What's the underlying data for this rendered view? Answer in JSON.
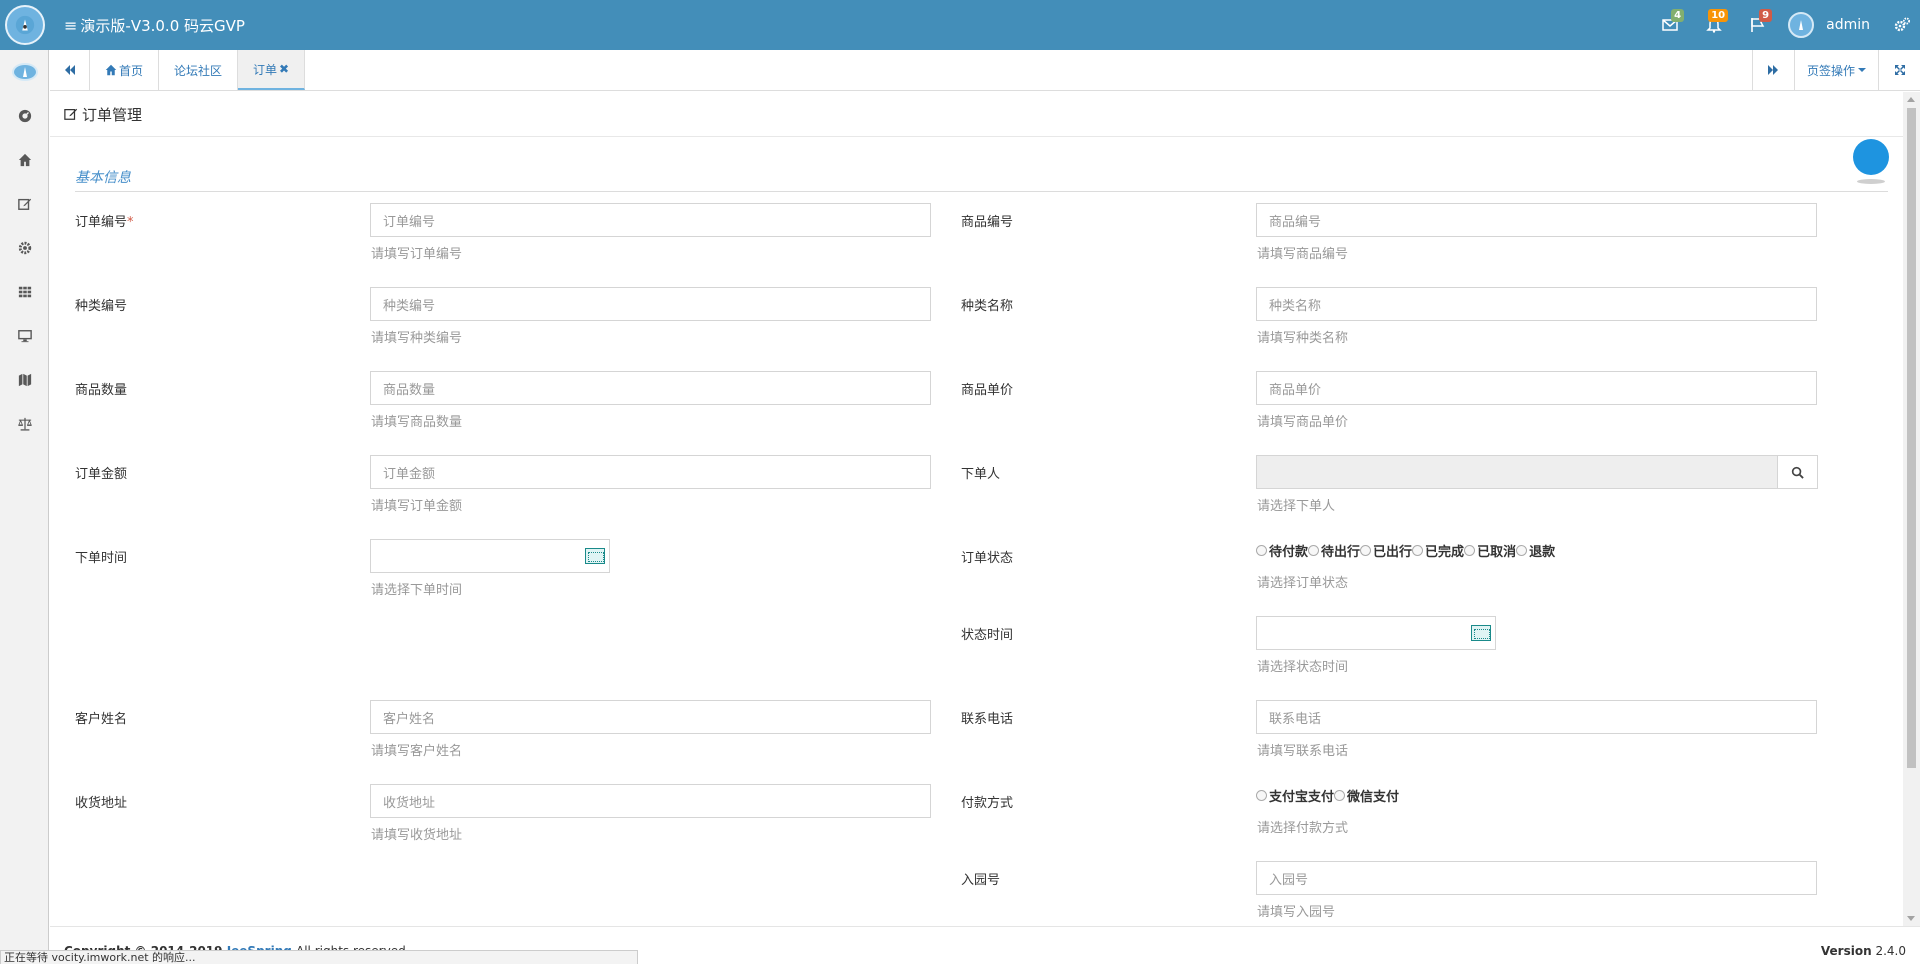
{
  "navbar": {
    "title": "演示版-V3.0.0 码云GVP",
    "badges": {
      "mail": "4",
      "bell": "10",
      "flag": "9"
    },
    "username": "admin",
    "colors": {
      "bar": "#438eb9"
    }
  },
  "sidebar": {
    "items": [
      "dashboard-icon",
      "home-icon",
      "edit-icon",
      "gear-icon",
      "grid-icon",
      "desktop-icon",
      "map-icon",
      "balance-icon"
    ]
  },
  "tabs": {
    "items": [
      {
        "label": "首页"
      },
      {
        "label": "论坛社区"
      },
      {
        "label": "订单",
        "close": "✖"
      }
    ],
    "page_ops": "页签操作"
  },
  "page": {
    "title": "订单管理"
  },
  "form": {
    "section": "基本信息",
    "order_no": {
      "label": "订单编号",
      "required": "*",
      "placeholder": "订单编号",
      "help": "请填写订单编号"
    },
    "product_no": {
      "label": "商品编号",
      "placeholder": "商品编号",
      "help": "请填写商品编号"
    },
    "category_no": {
      "label": "种类编号",
      "placeholder": "种类编号",
      "help": "请填写种类编号"
    },
    "category_name": {
      "label": "种类名称",
      "placeholder": "种类名称",
      "help": "请填写种类名称"
    },
    "quantity": {
      "label": "商品数量",
      "placeholder": "商品数量",
      "help": "请填写商品数量"
    },
    "unit_price": {
      "label": "商品单价",
      "placeholder": "商品单价",
      "help": "请填写商品单价"
    },
    "amount": {
      "label": "订单金额",
      "placeholder": "订单金额",
      "help": "请填写订单金额"
    },
    "orderer": {
      "label": "下单人",
      "help": "请选择下单人"
    },
    "order_time": {
      "label": "下单时间",
      "help": "请选择下单时间"
    },
    "order_status": {
      "label": "订单状态",
      "options": [
        "待付款",
        "待出行",
        "已出行",
        "已完成",
        "已取消",
        "退款"
      ],
      "help": "请选择订单状态"
    },
    "status_time": {
      "label": "状态时间",
      "help": "请选择状态时间"
    },
    "customer_name": {
      "label": "客户姓名",
      "placeholder": "客户姓名",
      "help": "请填写客户姓名"
    },
    "phone": {
      "label": "联系电话",
      "placeholder": "联系电话",
      "help": "请填写联系电话"
    },
    "address": {
      "label": "收货地址",
      "placeholder": "收货地址",
      "help": "请填写收货地址"
    },
    "payment": {
      "label": "付款方式",
      "options": [
        "支付宝支付",
        "微信支付"
      ],
      "help": "请选择付款方式"
    },
    "park_no": {
      "label": "入园号",
      "placeholder": "入园号",
      "help": "请填写入园号"
    }
  },
  "footer": {
    "copyright": "Copyright © 2014-2019",
    "brand": "JeeSpring",
    "rights": "All rights reserved.",
    "version_label": "Version",
    "version": "2.4.0"
  },
  "statusbar": {
    "text": "正在等待 vocity.imwork.net 的响应..."
  }
}
